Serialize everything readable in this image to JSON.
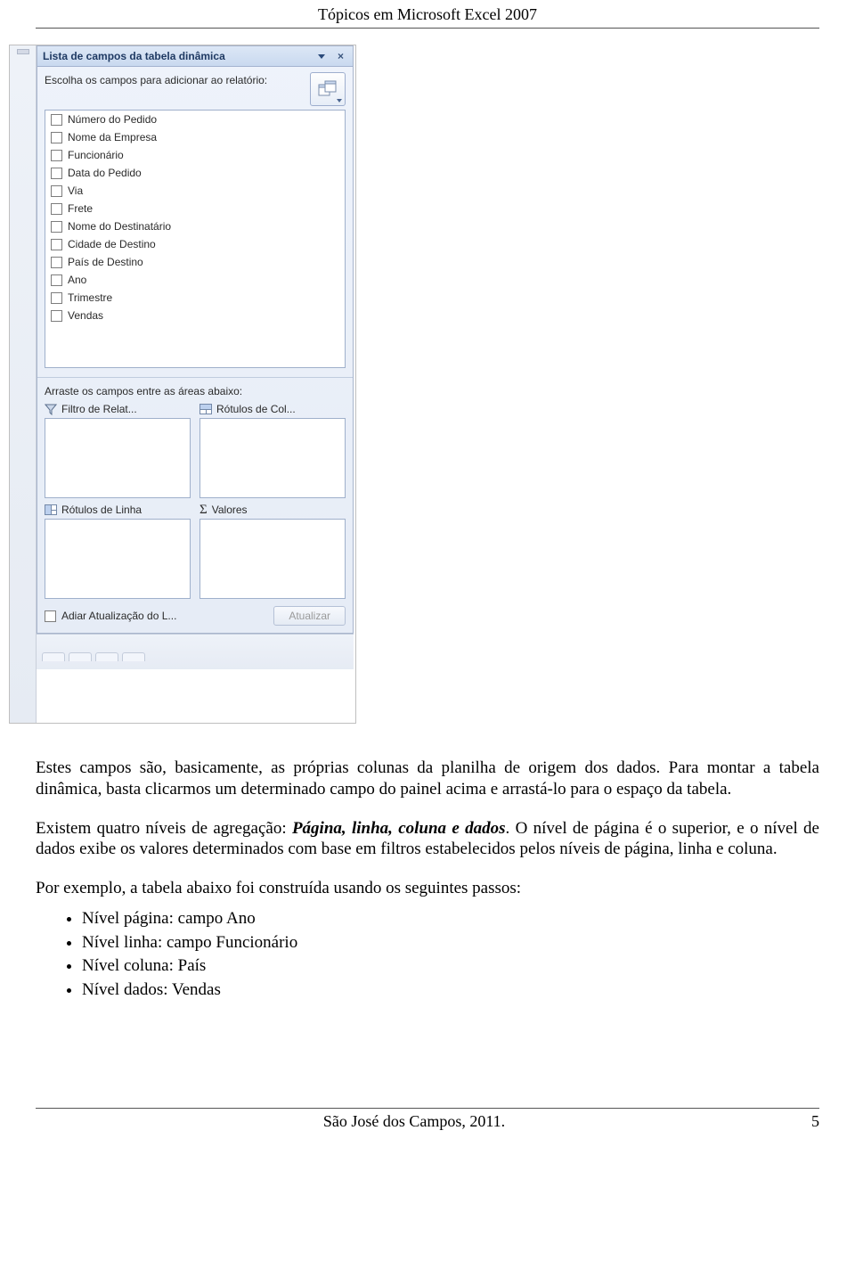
{
  "doc": {
    "header": "Tópicos em Microsoft Excel 2007",
    "footer_left": "São José dos Campos, 2011.",
    "footer_page": "5"
  },
  "pane": {
    "title": "Lista de campos da tabela dinâmica",
    "instruction": "Escolha os campos para adicionar ao relatório:",
    "fields": [
      "Número do Pedido",
      "Nome da Empresa",
      "Funcionário",
      "Data do Pedido",
      "Via",
      "Frete",
      "Nome do Destinatário",
      "Cidade de Destino",
      "País de Destino",
      "Ano",
      "Trimestre",
      "Vendas"
    ],
    "drag_instruction": "Arraste os campos entre as áreas abaixo:",
    "areas": {
      "filter": "Filtro de Relat...",
      "columns": "Rótulos de Col...",
      "rows": "Rótulos de Linha",
      "values": "Valores"
    },
    "defer_label": "Adiar Atualização do L...",
    "update_btn": "Atualizar"
  },
  "body": {
    "p1": "Estes campos são, basicamente, as próprias colunas da planilha de origem dos dados. Para montar a tabela dinâmica, basta clicarmos um determinado campo do painel acima e arrastá-lo para o espaço da tabela.",
    "p2_a": "Existem quatro níveis de agregação: ",
    "p2_em": "Página, linha, coluna e dados",
    "p2_b": ". O nível de página é o superior, e o nível de dados exibe os valores determinados com base em filtros estabelecidos pelos níveis de página, linha e coluna.",
    "p3": "Por exemplo, a tabela abaixo foi construída usando os seguintes passos:",
    "bullets": [
      "Nível página: campo Ano",
      "Nível linha: campo Funcionário",
      "Nível coluna: País",
      "Nível dados: Vendas"
    ]
  }
}
